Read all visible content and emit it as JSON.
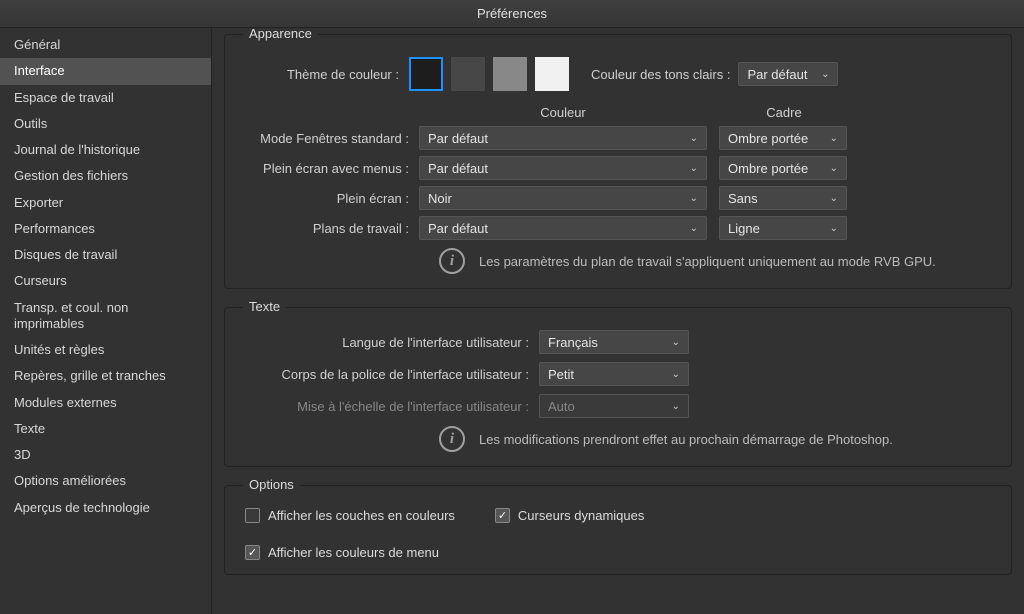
{
  "window": {
    "title": "Préférences"
  },
  "sidebar": {
    "items": [
      {
        "label": "Général"
      },
      {
        "label": "Interface"
      },
      {
        "label": "Espace de travail"
      },
      {
        "label": "Outils"
      },
      {
        "label": "Journal de l'historique"
      },
      {
        "label": "Gestion des fichiers"
      },
      {
        "label": "Exporter"
      },
      {
        "label": "Performances"
      },
      {
        "label": "Disques de travail"
      },
      {
        "label": "Curseurs"
      },
      {
        "label": "Transp. et coul. non imprimables"
      },
      {
        "label": "Unités et règles"
      },
      {
        "label": "Repères, grille et tranches"
      },
      {
        "label": "Modules externes"
      },
      {
        "label": "Texte"
      },
      {
        "label": "3D"
      },
      {
        "label": "Options améliorées"
      },
      {
        "label": "Aperçus de technologie"
      }
    ],
    "selected_index": 1
  },
  "appearance": {
    "title": "Apparence",
    "color_theme_label": "Thème de couleur :",
    "highlight_label": "Couleur des tons clairs :",
    "highlight_value": "Par défaut",
    "headers": {
      "color": "Couleur",
      "frame": "Cadre"
    },
    "modes": [
      {
        "label": "Mode Fenêtres standard :",
        "color": "Par défaut",
        "frame": "Ombre portée"
      },
      {
        "label": "Plein écran avec menus :",
        "color": "Par défaut",
        "frame": "Ombre portée"
      },
      {
        "label": "Plein écran :",
        "color": "Noir",
        "frame": "Sans"
      },
      {
        "label": "Plans de travail :",
        "color": "Par défaut",
        "frame": "Ligne"
      }
    ],
    "info": "Les paramètres du plan de travail s'appliquent uniquement au mode RVB GPU."
  },
  "text_section": {
    "title": "Texte",
    "ui_language_label": "Langue de l'interface utilisateur :",
    "ui_language_value": "Français",
    "font_body_label": "Corps de la police de l'interface utilisateur :",
    "font_body_value": "Petit",
    "ui_scale_label": "Mise à l'échelle de l'interface utilisateur :",
    "ui_scale_value": "Auto",
    "info": "Les modifications prendront effet au prochain démarrage de Photoshop."
  },
  "options": {
    "title": "Options",
    "show_channels": {
      "label": "Afficher les couches en couleurs",
      "checked": false
    },
    "dynamic_cursors": {
      "label": "Curseurs dynamiques",
      "checked": true
    },
    "show_menu_colors": {
      "label": "Afficher les couleurs de menu",
      "checked": true
    }
  }
}
